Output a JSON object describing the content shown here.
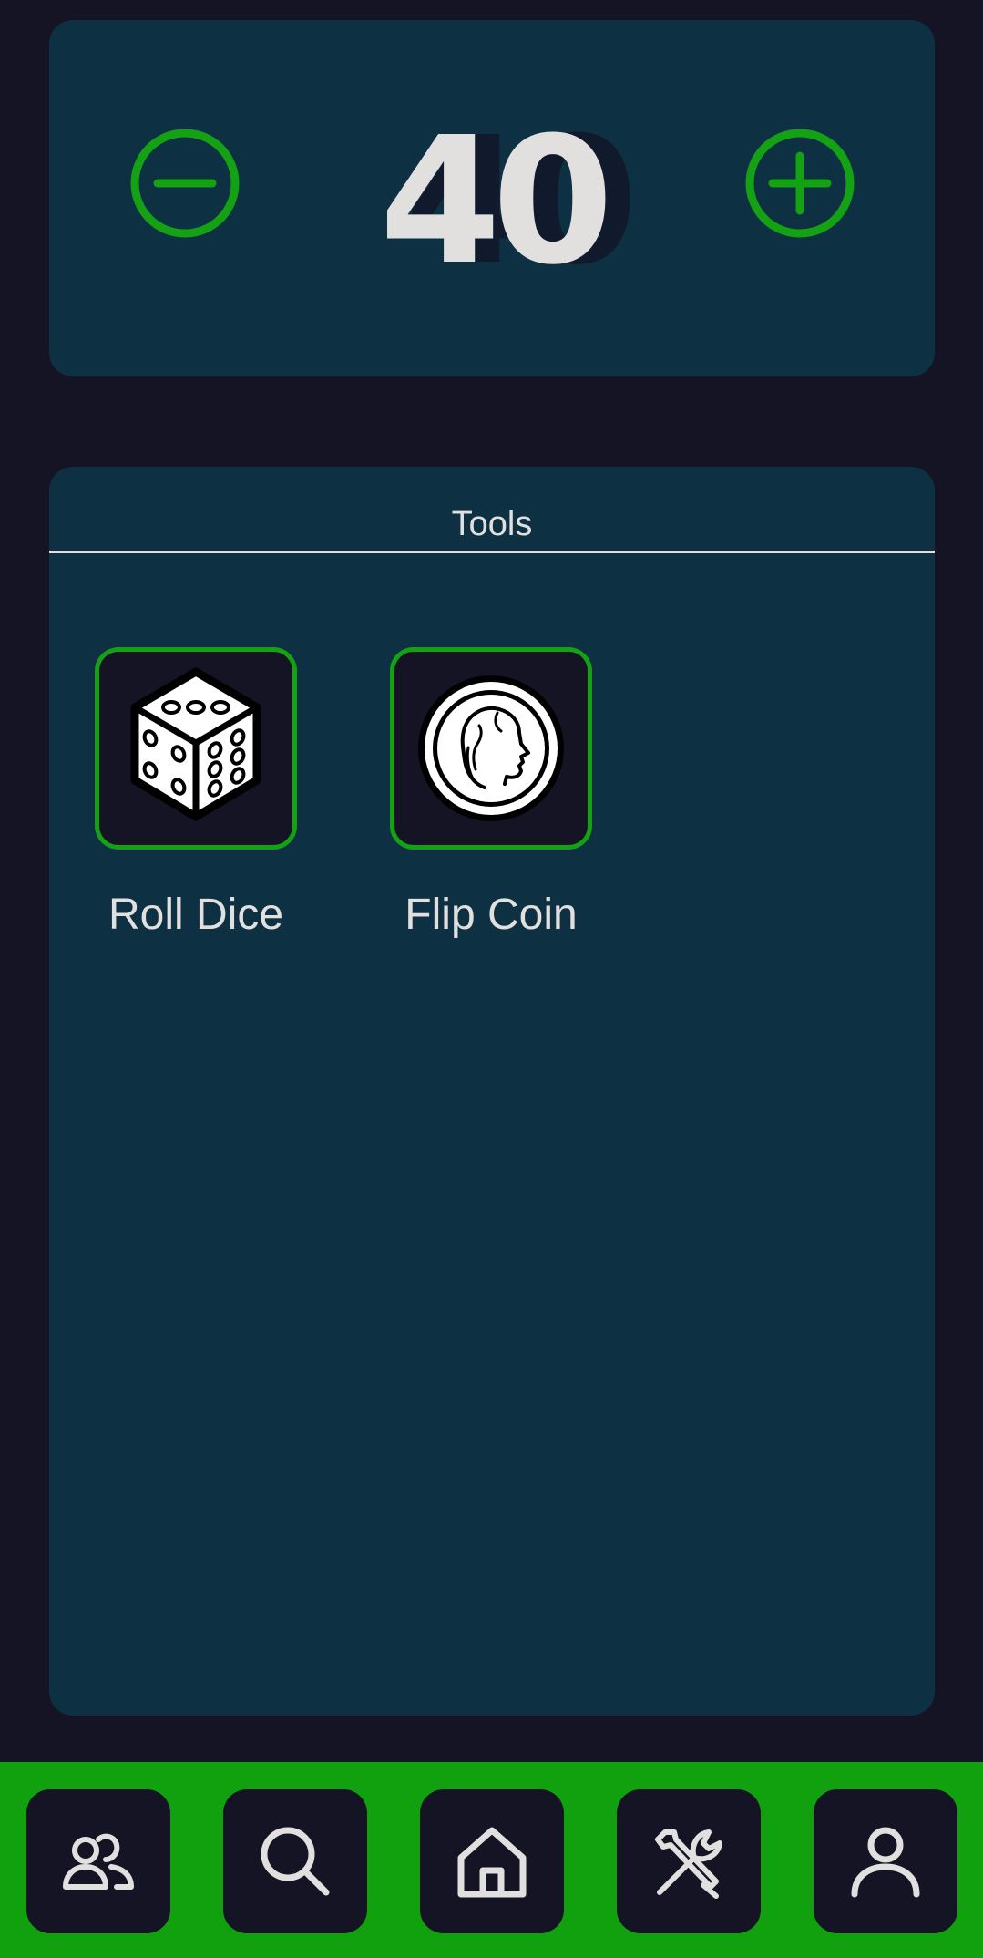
{
  "counter": {
    "value": "40"
  },
  "tools": {
    "title": "Tools",
    "items": [
      {
        "label": "Roll Dice",
        "icon": "dice-icon"
      },
      {
        "label": "Flip Coin",
        "icon": "coin-icon"
      }
    ]
  },
  "nav": {
    "items": [
      {
        "icon": "users-icon"
      },
      {
        "icon": "search-icon"
      },
      {
        "icon": "home-icon"
      },
      {
        "icon": "tools-icon"
      },
      {
        "icon": "user-icon"
      }
    ]
  },
  "colors": {
    "background": "#141424",
    "card": "#0d3042",
    "accent_green": "#14a114",
    "nav_green": "#11a10f",
    "text": "#e2dfdf"
  }
}
